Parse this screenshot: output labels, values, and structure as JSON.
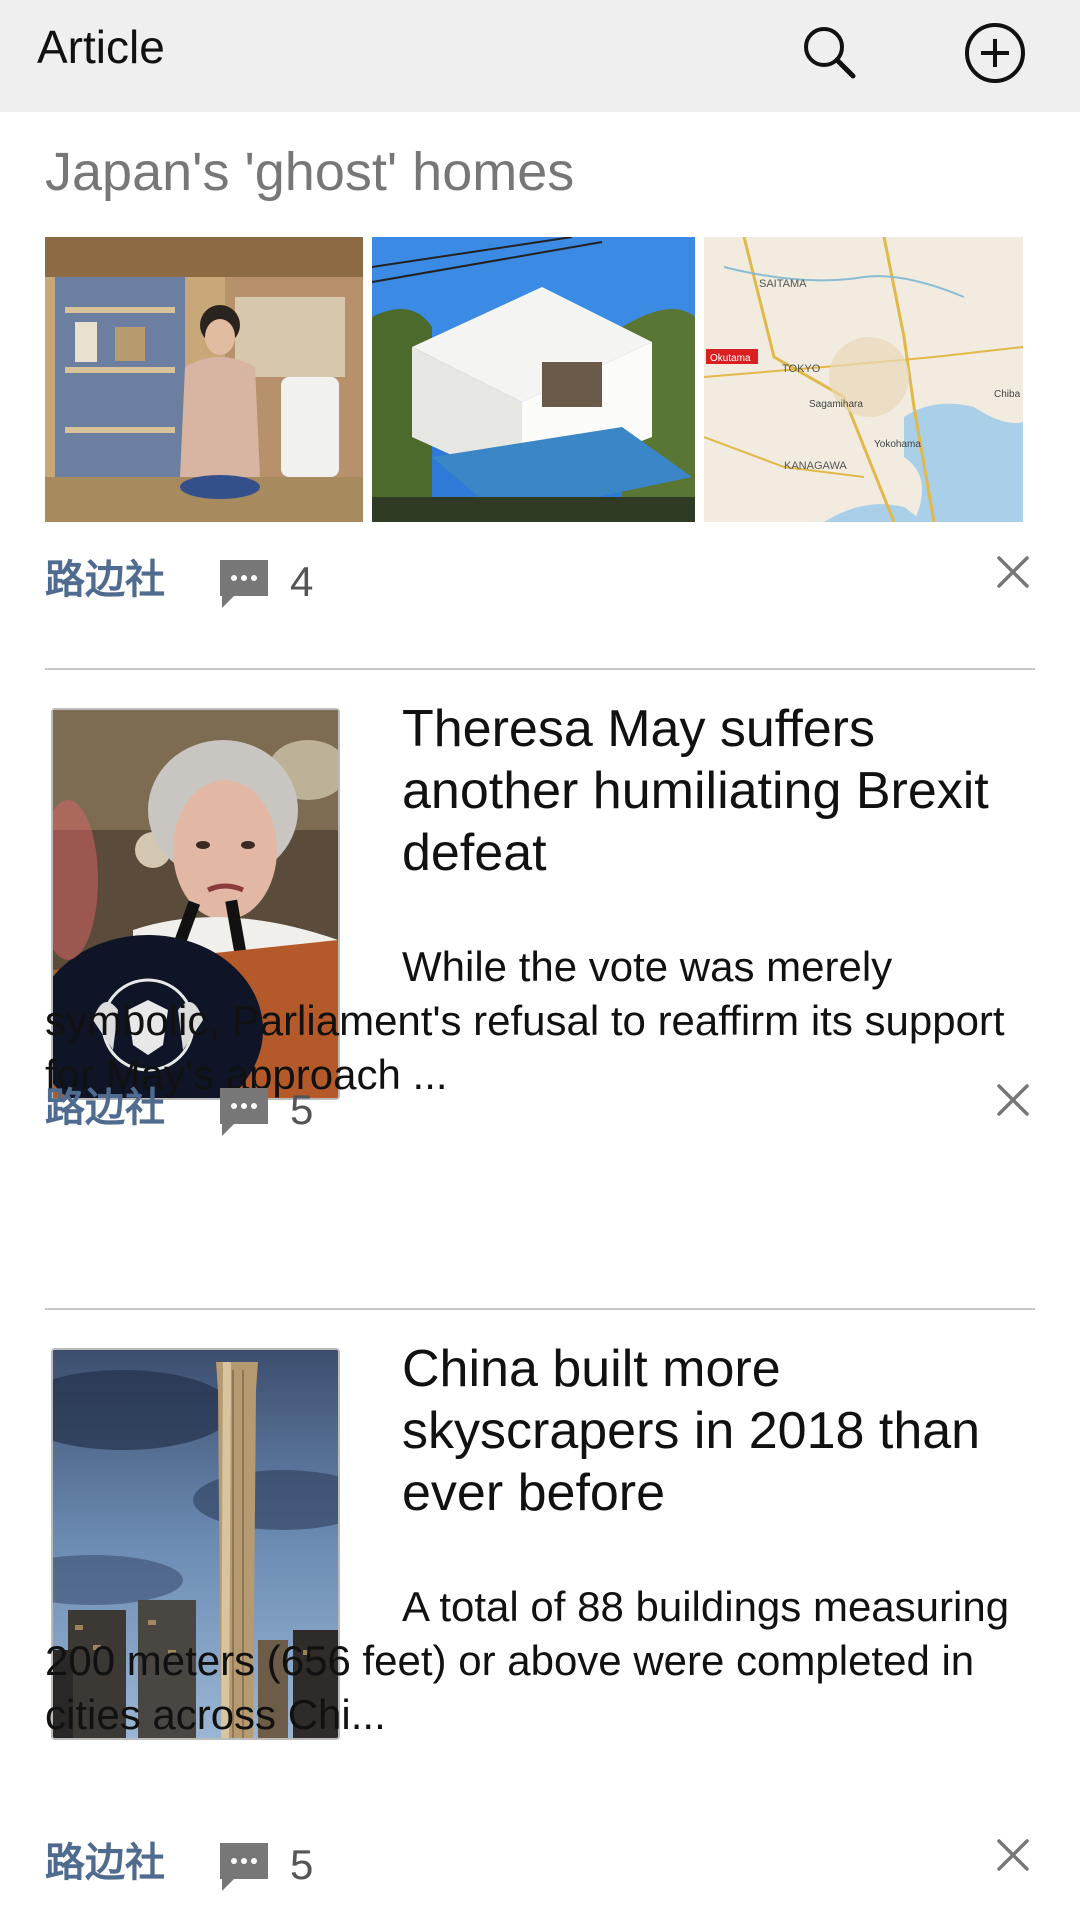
{
  "app_bar": {
    "title": "Article",
    "search_icon": "search-icon",
    "add_icon": "add-circle-icon"
  },
  "articles": [
    {
      "headline": "Japan's 'ghost' homes",
      "source": "路边社",
      "comments": "4"
    },
    {
      "title": "Theresa May suffers another humiliating Brexit defeat",
      "summary": "While the vote was merely symbolic, Parliament's refusal to reaffirm its support for May's approach ...",
      "source": "路边社",
      "comments": "5"
    },
    {
      "title": "China built more skyscrapers in 2018 than ever before",
      "summary": "A total of 88 buildings measuring 200 meters (656 feet) or above were completed in cities across Chi...",
      "source": "路边社",
      "comments": "5"
    }
  ],
  "map_labels": {
    "saitama": "SAITAMA",
    "okutama": "Okutama",
    "tokyo": "TOKYO",
    "kanagawa": "KANAGAWA",
    "yokohama": "Yokohama",
    "sagamihara": "Sagamihara",
    "chiba": "Chiba"
  },
  "colors": {
    "source": "#4f6b8f",
    "topbar": "#efefef",
    "divider": "#c6c6c6"
  }
}
